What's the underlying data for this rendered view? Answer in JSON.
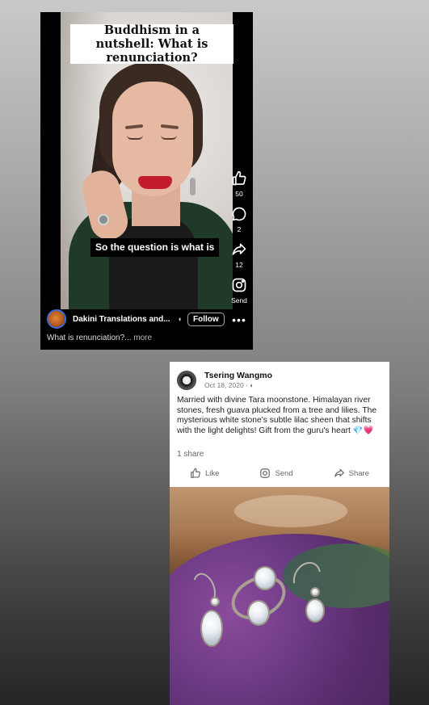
{
  "reel": {
    "title_caption": "Buddhism in a nutshell: What is renunciation?",
    "subtitle": "So the question is what is",
    "actions": {
      "like_count": "50",
      "comment_count": "2",
      "share_count": "12",
      "send_label": "Send"
    },
    "channel_name": "Dakini Translations and...",
    "follow_label": "Follow",
    "description": "What is renunciation?...",
    "more_label": "more"
  },
  "post": {
    "author": "Tsering Wangmo",
    "date": "Oct 18, 2020 ·",
    "text": "Married with divine Tara moonstone. Himalayan river stones, fresh guava plucked from a tree and lilies. The mysterious white stone's subtle lilac sheen that shifts with the light delights! Gift from the guru's heart",
    "emoji_gem": "💎",
    "emoji_heart": "💗",
    "shares": "1 share",
    "like_label": "Like",
    "send_label": "Send",
    "share_label": "Share"
  },
  "colors": {
    "accent_blue": "#3b6fd6",
    "lip_red": "#c31d2d",
    "fabric_purple": "#6e3a86"
  }
}
